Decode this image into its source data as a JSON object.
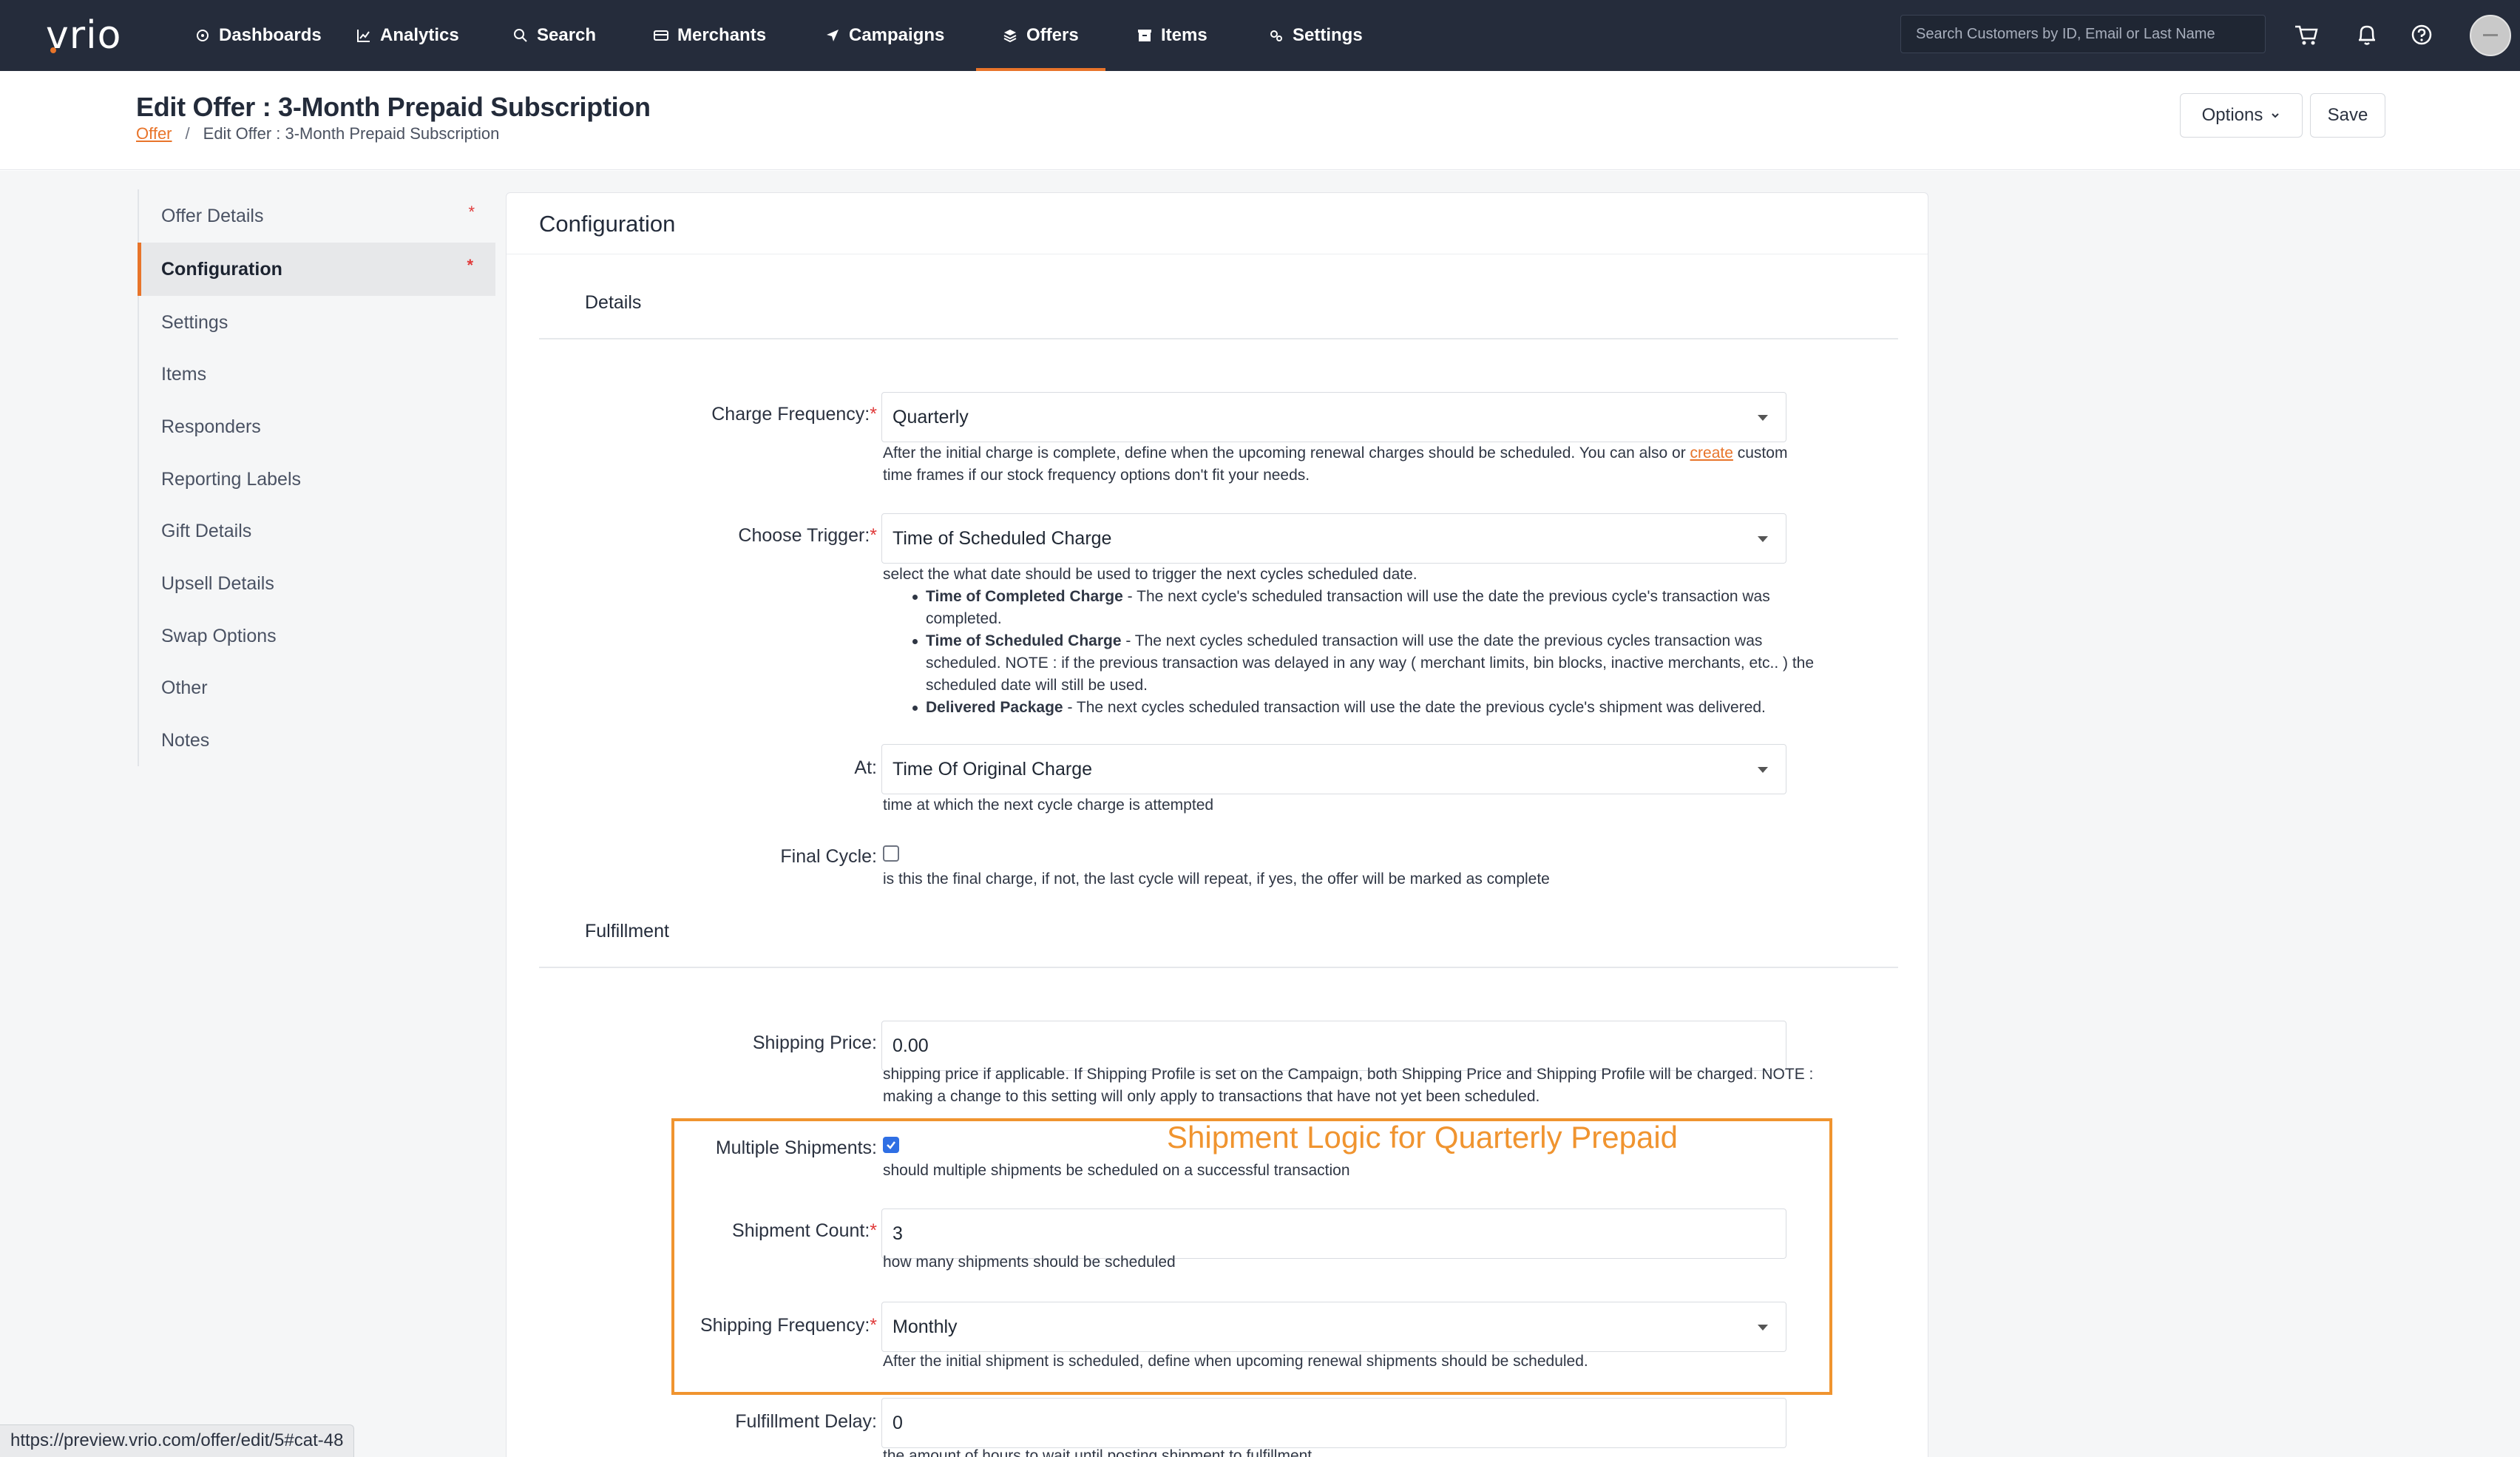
{
  "brand": {
    "logo_text": "vrio",
    "accent": "#e8742a"
  },
  "nav": {
    "items": [
      {
        "label": "Dashboards",
        "icon": "dashboard-icon"
      },
      {
        "label": "Analytics",
        "icon": "chart-line-icon"
      },
      {
        "label": "Search",
        "icon": "search-icon"
      },
      {
        "label": "Merchants",
        "icon": "credit-card-icon"
      },
      {
        "label": "Campaigns",
        "icon": "paper-plane-icon"
      },
      {
        "label": "Offers",
        "icon": "layers-icon",
        "active": true
      },
      {
        "label": "Items",
        "icon": "box-icon"
      },
      {
        "label": "Settings",
        "icon": "gears-icon"
      }
    ],
    "search_placeholder": "Search Customers by ID, Email or Last Name"
  },
  "header": {
    "title": "Edit Offer : 3-Month Prepaid Subscription",
    "breadcrumb_link": "Offer",
    "breadcrumb_sep": "/",
    "breadcrumb_current": "Edit Offer : 3-Month Prepaid Subscription",
    "options_label": "Options",
    "save_label": "Save"
  },
  "sidebar": {
    "items": [
      {
        "label": "Offer Details",
        "required": "*"
      },
      {
        "label": "Configuration",
        "required": "*",
        "active": true
      },
      {
        "label": "Settings"
      },
      {
        "label": "Items"
      },
      {
        "label": "Responders"
      },
      {
        "label": "Reporting Labels"
      },
      {
        "label": "Gift Details"
      },
      {
        "label": "Upsell Details"
      },
      {
        "label": "Swap Options"
      },
      {
        "label": "Other"
      },
      {
        "label": "Notes"
      }
    ]
  },
  "panel": {
    "title": "Configuration",
    "details_title": "Details",
    "fulfillment_title": "Fulfillment"
  },
  "fields": {
    "charge_frequency": {
      "label": "Charge Frequency:",
      "value": "Quarterly",
      "help_before": "After the initial charge is complete, define when the upcoming renewal charges should be scheduled. You can also or",
      "help_link": "create",
      "help_after": "custom",
      "help_line2": "time frames if our stock frequency options don't fit your needs."
    },
    "choose_trigger": {
      "label": "Choose Trigger:",
      "value": "Time of Scheduled Charge",
      "help": "select the what date should be used to trigger the next cycles scheduled date.",
      "bullets": [
        {
          "bold": "Time of Completed Charge",
          "text": " - The next cycle's scheduled transaction will use the date the previous cycle's transaction was",
          "line2": "completed."
        },
        {
          "bold": "Time of Scheduled Charge",
          "text": " - The next cycles scheduled transaction will use the date the previous cycles transaction was",
          "line2": "scheduled. NOTE : if the previous transaction was delayed in any way ( merchant limits, bin blocks, inactive merchants, etc.. ) the",
          "line3": "scheduled date will still be used."
        },
        {
          "bold": "Delivered Package",
          "text": " - The next cycles scheduled transaction will use the date the previous cycle's shipment was delivered."
        }
      ]
    },
    "at": {
      "label": "At:",
      "value": "Time Of Original Charge",
      "help": "time at which the next cycle charge is attempted"
    },
    "final_cycle": {
      "label": "Final Cycle:",
      "checked": false,
      "help": "is this the final charge, if not, the last cycle will repeat, if yes, the offer will be marked as complete"
    },
    "shipping_price": {
      "label": "Shipping Price:",
      "value": "0.00",
      "help_line1": "shipping price if applicable. If Shipping Profile is set on the Campaign, both Shipping Price and Shipping Profile will be charged. NOTE :",
      "help_line2": "making a change to this setting will only apply to transactions that have not yet been scheduled."
    },
    "multiple_shipments": {
      "label": "Multiple Shipments:",
      "checked": true,
      "help": "should multiple shipments be scheduled on a successful transaction"
    },
    "shipment_count": {
      "label": "Shipment Count:",
      "value": "3",
      "help": "how many shipments should be scheduled"
    },
    "shipping_frequency": {
      "label": "Shipping Frequency:",
      "value": "Monthly",
      "help": "After the initial shipment is scheduled, define when upcoming renewal shipments should be scheduled."
    },
    "fulfillment_delay": {
      "label": "Fulfillment Delay:",
      "value": "0",
      "help": "the amount of hours to wait until posting shipment to fulfillment"
    }
  },
  "annotation": {
    "caption": "Shipment Logic for Quarterly Prepaid",
    "color": "#f0942f"
  },
  "status_bar": {
    "url": "https://preview.vrio.com/offer/edit/5#cat-48"
  }
}
